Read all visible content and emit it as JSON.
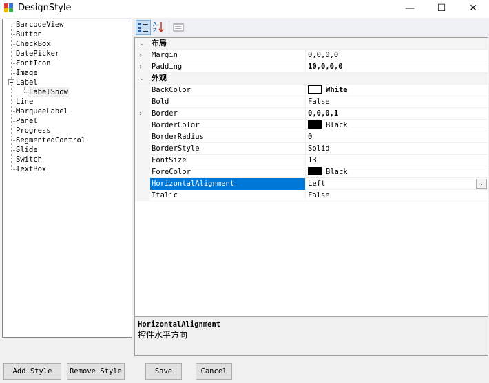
{
  "window": {
    "title": "DesignStyle",
    "minimize": "—",
    "maximize": "☐",
    "close": "✕"
  },
  "tree": {
    "items": [
      "BarcodeView",
      "Button",
      "CheckBox",
      "DatePicker",
      "FontIcon",
      "Image",
      "Label",
      "Line",
      "MarqueeLabel",
      "Panel",
      "Progress",
      "SegmentedControl",
      "Slide",
      "Switch",
      "TextBox"
    ],
    "child_of_label": "LabelShow"
  },
  "toolbar": {
    "categorized_icon": "categorized-icon",
    "alphabetical_icon": "alphabetical-icon",
    "property_pages_icon": "property-pages-icon"
  },
  "grid": {
    "cat_layout": "布局",
    "cat_appearance": "外观",
    "props": {
      "margin": {
        "name": "Margin",
        "value": "0,0,0,0"
      },
      "padding": {
        "name": "Padding",
        "value": "10,0,0,0"
      },
      "backcolor": {
        "name": "BackColor",
        "value": "White",
        "swatch": "#ffffff"
      },
      "bold": {
        "name": "Bold",
        "value": "False"
      },
      "border": {
        "name": "Border",
        "value": "0,0,0,1"
      },
      "bordercolor": {
        "name": "BorderColor",
        "value": "Black",
        "swatch": "#000000"
      },
      "borderradius": {
        "name": "BorderRadius",
        "value": "0"
      },
      "borderstyle": {
        "name": "BorderStyle",
        "value": "Solid"
      },
      "fontsize": {
        "name": "FontSize",
        "value": "13"
      },
      "forecolor": {
        "name": "ForeColor",
        "value": "Black",
        "swatch": "#000000"
      },
      "horizontalalignment": {
        "name": "HorizontalAlignment",
        "value": "Left"
      },
      "italic": {
        "name": "Italic",
        "value": "False"
      }
    }
  },
  "description": {
    "title": "HorizontalAlignment",
    "text": "控件水平方向"
  },
  "buttons": {
    "add_style": "Add Style",
    "remove_style": "Remove Style",
    "save": "Save",
    "cancel": "Cancel"
  },
  "colors": {
    "selection": "#0078d7",
    "toolbar_active": "#c7dff5"
  }
}
